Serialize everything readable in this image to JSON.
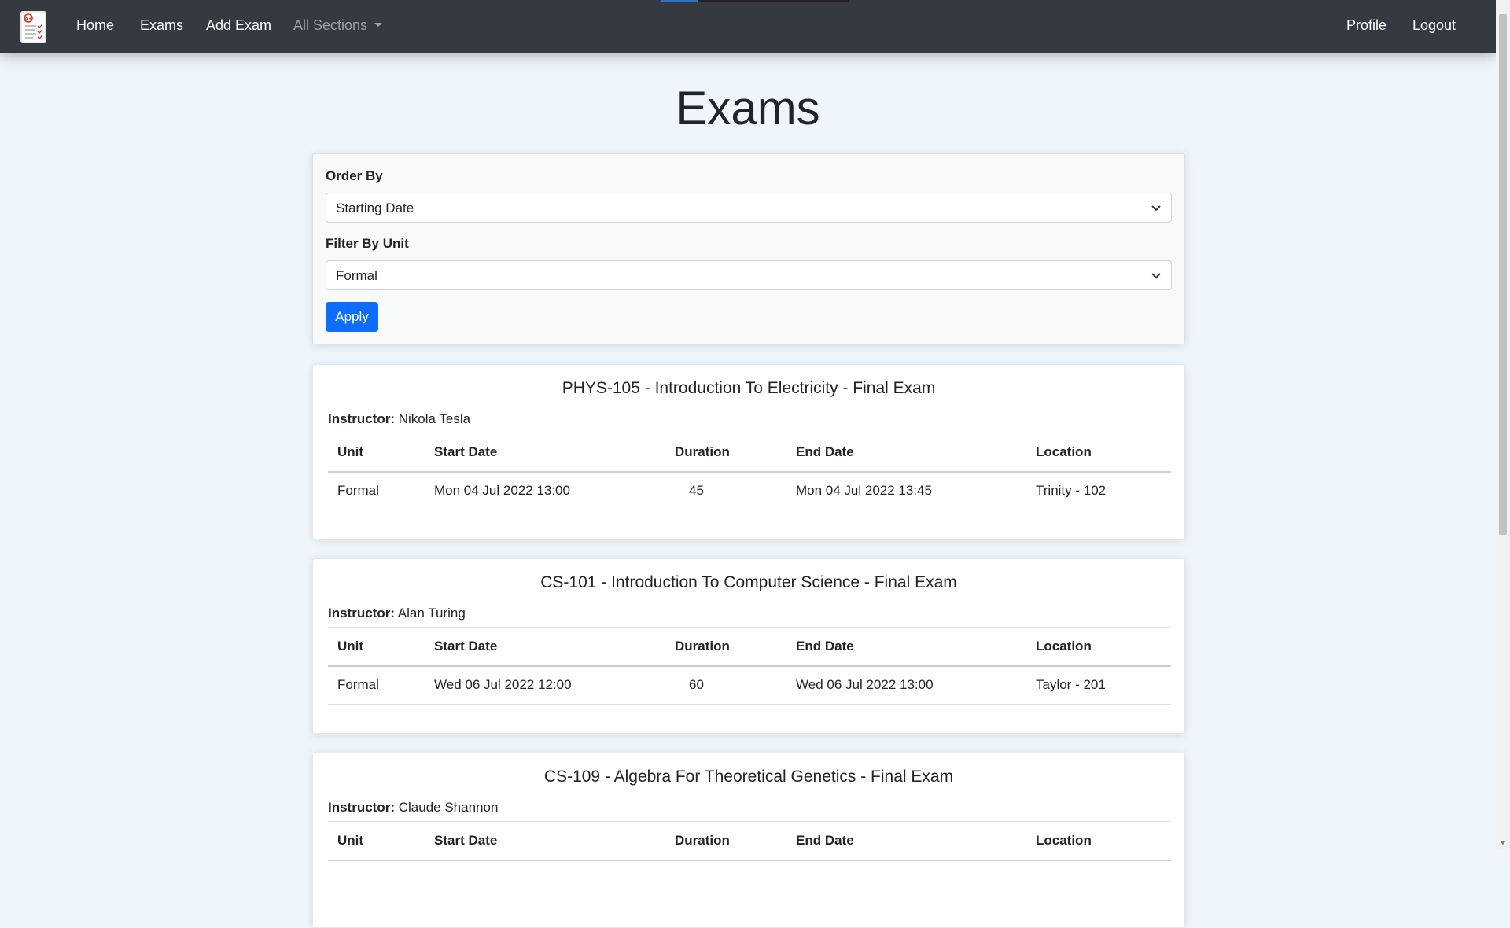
{
  "navbar": {
    "brand_icon": "exam-document-icon",
    "links": [
      "Home",
      "Exams",
      "Add Exam"
    ],
    "dropdown_label": "All Sections",
    "right_links": [
      "Profile",
      "Logout"
    ]
  },
  "page": {
    "title": "Exams"
  },
  "filters": {
    "order_by_label": "Order By",
    "order_by_value": "Starting Date",
    "filter_unit_label": "Filter By Unit",
    "filter_unit_value": "Formal",
    "apply_label": "Apply"
  },
  "table_headers": [
    "Unit",
    "Start Date",
    "Duration",
    "End Date",
    "Location"
  ],
  "exams": [
    {
      "title": "PHYS-105 - Introduction To Electricity - Final Exam",
      "instructor_label": "Instructor:",
      "instructor": "Nikola Tesla",
      "rows": [
        [
          "Formal",
          "Mon 04 Jul 2022 13:00",
          "45",
          "Mon 04 Jul 2022 13:45",
          "Trinity - 102"
        ]
      ]
    },
    {
      "title": "CS-101 - Introduction To Computer Science - Final Exam",
      "instructor_label": "Instructor:",
      "instructor": "Alan Turing",
      "rows": [
        [
          "Formal",
          "Wed 06 Jul 2022 12:00",
          "60",
          "Wed 06 Jul 2022 13:00",
          "Taylor - 201"
        ]
      ]
    },
    {
      "title": "CS-109 - Algebra For Theoretical Genetics - Final Exam",
      "instructor_label": "Instructor:",
      "instructor": "Claude Shannon",
      "rows": []
    }
  ],
  "colors": {
    "navbar_bg": "#343a40",
    "page_bg": "#eef6fc",
    "primary": "#0d6efd"
  }
}
